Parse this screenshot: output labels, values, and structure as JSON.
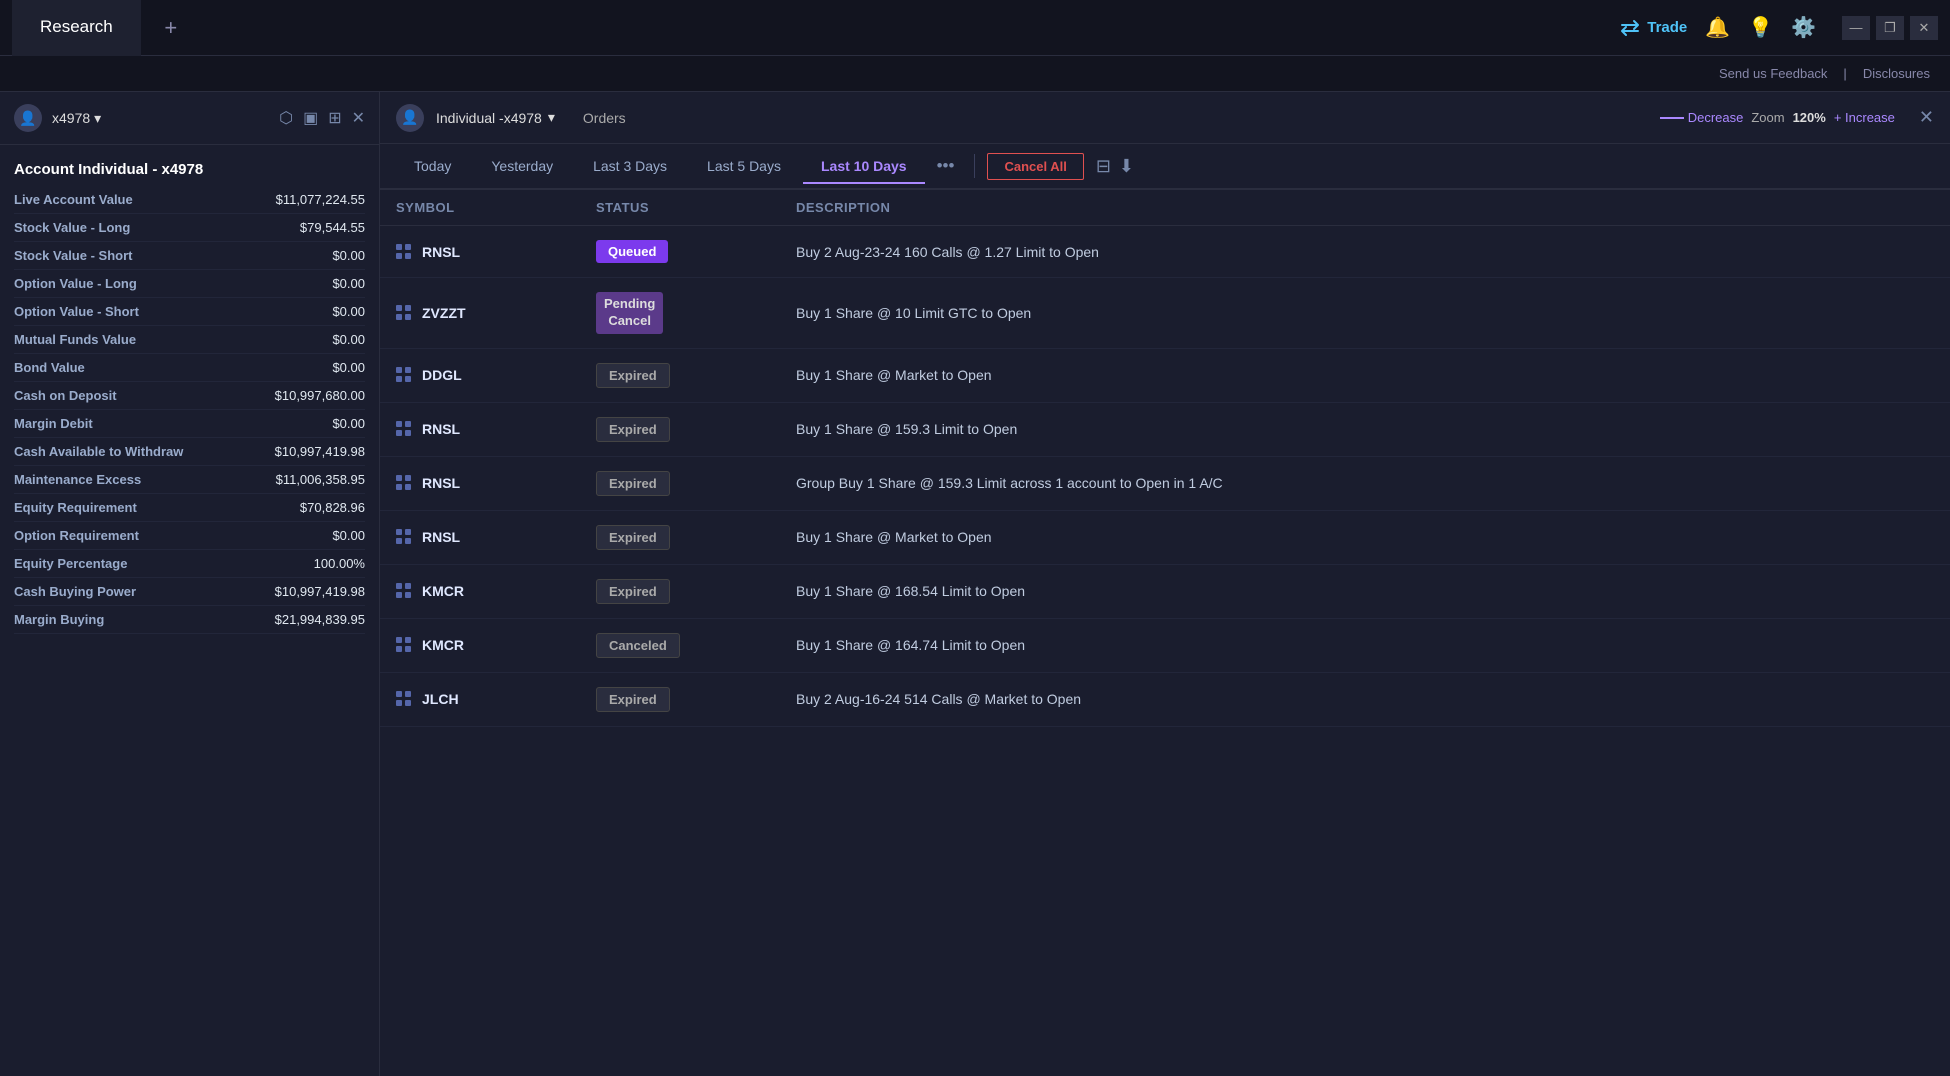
{
  "topbar": {
    "tab_research": "Research",
    "tab_add_icon": "+",
    "trade_label": "Trade",
    "feedback_label": "Send us Feedback",
    "feedback_separator": "|",
    "disclosures_label": "Disclosures",
    "window_minimize": "—",
    "window_restore": "❐",
    "window_close": "✕"
  },
  "sidebar": {
    "account_id": "x4978",
    "account_title": "Account Individual - x4978",
    "rows": [
      {
        "label": "Live Account Value",
        "value": "$11,077,224.55"
      },
      {
        "label": "Stock Value - Long",
        "value": "$79,544.55"
      },
      {
        "label": "Stock Value - Short",
        "value": "$0.00"
      },
      {
        "label": "Option Value - Long",
        "value": "$0.00"
      },
      {
        "label": "Option Value - Short",
        "value": "$0.00"
      },
      {
        "label": "Mutual Funds Value",
        "value": "$0.00"
      },
      {
        "label": "Bond Value",
        "value": "$0.00"
      },
      {
        "label": "Cash on Deposit",
        "value": "$10,997,680.00"
      },
      {
        "label": "Margin Debit",
        "value": "$0.00"
      },
      {
        "label": "Cash Available to Withdraw",
        "value": "$10,997,419.98"
      },
      {
        "label": "Maintenance Excess",
        "value": "$11,006,358.95"
      },
      {
        "label": "Equity Requirement",
        "value": "$70,828.96"
      },
      {
        "label": "Option Requirement",
        "value": "$0.00"
      },
      {
        "label": "Equity Percentage",
        "value": "100.00%"
      },
      {
        "label": "Cash Buying Power",
        "value": "$10,997,419.98"
      },
      {
        "label": "Margin Buying",
        "value": "$21,994,839.95"
      }
    ]
  },
  "content": {
    "account_label": "Individual -x4978",
    "orders_text": "Orders",
    "decrease_label": "Decrease",
    "zoom_label": "Zoom",
    "zoom_value": "120%",
    "increase_label": "+ Increase",
    "tabs": [
      {
        "label": "Today",
        "active": false
      },
      {
        "label": "Yesterday",
        "active": false
      },
      {
        "label": "Last 3 Days",
        "active": false
      },
      {
        "label": "Last 5 Days",
        "active": false
      },
      {
        "label": "Last 10 Days",
        "active": true
      }
    ],
    "more_icon": "•••",
    "cancel_all_label": "Cancel All",
    "columns": [
      {
        "label": "Symbol"
      },
      {
        "label": "Status"
      },
      {
        "label": "Description"
      }
    ],
    "orders": [
      {
        "symbol": "RNSL",
        "status": "Queued",
        "status_type": "queued",
        "description": "Buy 2 Aug-23-24 160 Calls @ 1.27 Limit to Open"
      },
      {
        "symbol": "ZVZZT",
        "status": "Pending Cancel",
        "status_type": "pending-cancel",
        "description": "Buy 1 Share @ 10 Limit GTC to Open"
      },
      {
        "symbol": "DDGL",
        "status": "Expired",
        "status_type": "expired",
        "description": "Buy 1 Share @ Market to Open"
      },
      {
        "symbol": "RNSL",
        "status": "Expired",
        "status_type": "expired",
        "description": "Buy 1 Share @ 159.3 Limit to Open"
      },
      {
        "symbol": "RNSL",
        "status": "Expired",
        "status_type": "expired",
        "description": "Group Buy 1 Share @ 159.3 Limit across 1 account to Open in 1 A/C"
      },
      {
        "symbol": "RNSL",
        "status": "Expired",
        "status_type": "expired",
        "description": "Buy 1 Share @ Market to Open"
      },
      {
        "symbol": "KMCR",
        "status": "Expired",
        "status_type": "expired",
        "description": "Buy 1 Share @ 168.54 Limit to Open"
      },
      {
        "symbol": "KMCR",
        "status": "Canceled",
        "status_type": "canceled",
        "description": "Buy 1 Share @ 164.74 Limit to Open"
      },
      {
        "symbol": "JLCH",
        "status": "Expired",
        "status_type": "expired",
        "description": "Buy 2 Aug-16-24 514 Calls @ Market to Open"
      }
    ]
  }
}
